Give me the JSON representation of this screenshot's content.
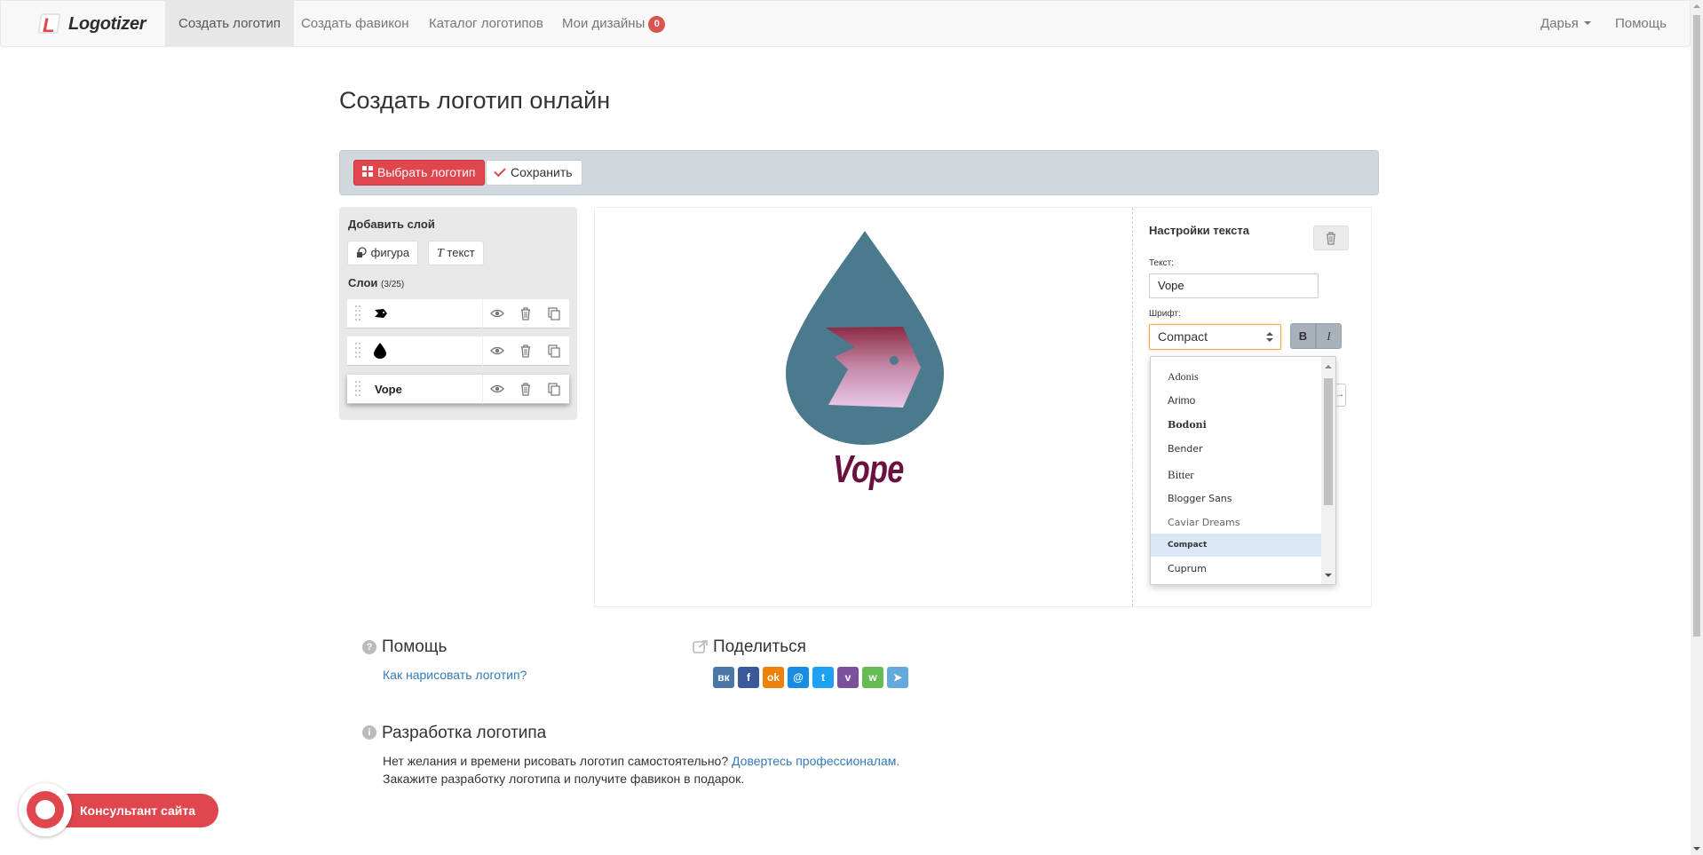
{
  "navbar": {
    "brand": "Logotizer",
    "items": [
      {
        "label": "Создать логотип",
        "active": true
      },
      {
        "label": "Создать фавикон"
      },
      {
        "label": "Каталог логотипов"
      },
      {
        "label": "Мои дизайны"
      }
    ],
    "designs_count": "0",
    "user": "Дарья",
    "help": "Помощь"
  },
  "page": {
    "title": "Создать логотип онлайн"
  },
  "toolbar": {
    "choose_label": "Выбрать логотип",
    "save_label": "Сохранить"
  },
  "layers": {
    "add_title": "Добавить слой",
    "add_shape": "фигура",
    "add_text": "текст",
    "title": "Слои",
    "count": "(3/25)",
    "rows": [
      {
        "type": "shape",
        "icon": "fish-icon",
        "label": ""
      },
      {
        "type": "shape",
        "icon": "drop-icon",
        "label": ""
      },
      {
        "type": "text",
        "label": "Vope",
        "selected": true
      }
    ]
  },
  "canvas": {
    "logo_text": "Vope",
    "colors": {
      "drop": "#4a7a8c",
      "fish_top": "#8c2a45",
      "fish_bottom": "#e8c8e8",
      "text": "#6b1140"
    }
  },
  "settings": {
    "title": "Настройки текста",
    "text_label": "Текст:",
    "text_value": "Vope",
    "font_label": "Шрифт:",
    "font_value": "Compact",
    "bold_label": "B",
    "italic_label": "I",
    "font_options": [
      {
        "name": "Adonis"
      },
      {
        "name": "Arimo"
      },
      {
        "name": "Bodoni"
      },
      {
        "name": "Bender"
      },
      {
        "name": "Bitter"
      },
      {
        "name": "Blogger Sans"
      },
      {
        "name": "Caviar Dreams"
      },
      {
        "name": "Compact",
        "selected": true
      },
      {
        "name": "Cuprum"
      }
    ]
  },
  "help": {
    "title": "Помощь",
    "link": "Как нарисовать логотип?"
  },
  "share": {
    "title": "Поделиться",
    "networks": [
      {
        "name": "vk",
        "label": "вк",
        "color": "#4a76a8"
      },
      {
        "name": "facebook",
        "label": "f",
        "color": "#3b5998"
      },
      {
        "name": "odnoklassniki",
        "label": "ok",
        "color": "#ee8208"
      },
      {
        "name": "moimir",
        "label": "@",
        "color": "#168de2"
      },
      {
        "name": "twitter",
        "label": "t",
        "color": "#1da1f2"
      },
      {
        "name": "viber",
        "label": "v",
        "color": "#7b519d"
      },
      {
        "name": "whatsapp",
        "label": "w",
        "color": "#65bc54"
      },
      {
        "name": "telegram",
        "label": "➤",
        "color": "#64a9dc"
      }
    ]
  },
  "development": {
    "title": "Разработка логотипа",
    "line1": "Нет желания и времени рисовать логотип самостоятельно?",
    "line1_link": "Довертесь профессионалам.",
    "line2": "Закажите разработку логотипа и получите фавикон в подарок."
  },
  "consultant": {
    "label": "Консультант сайта"
  },
  "colors": {
    "accent": "#e0464e",
    "link": "#337ab7",
    "toolbar": "#d0d8de"
  }
}
